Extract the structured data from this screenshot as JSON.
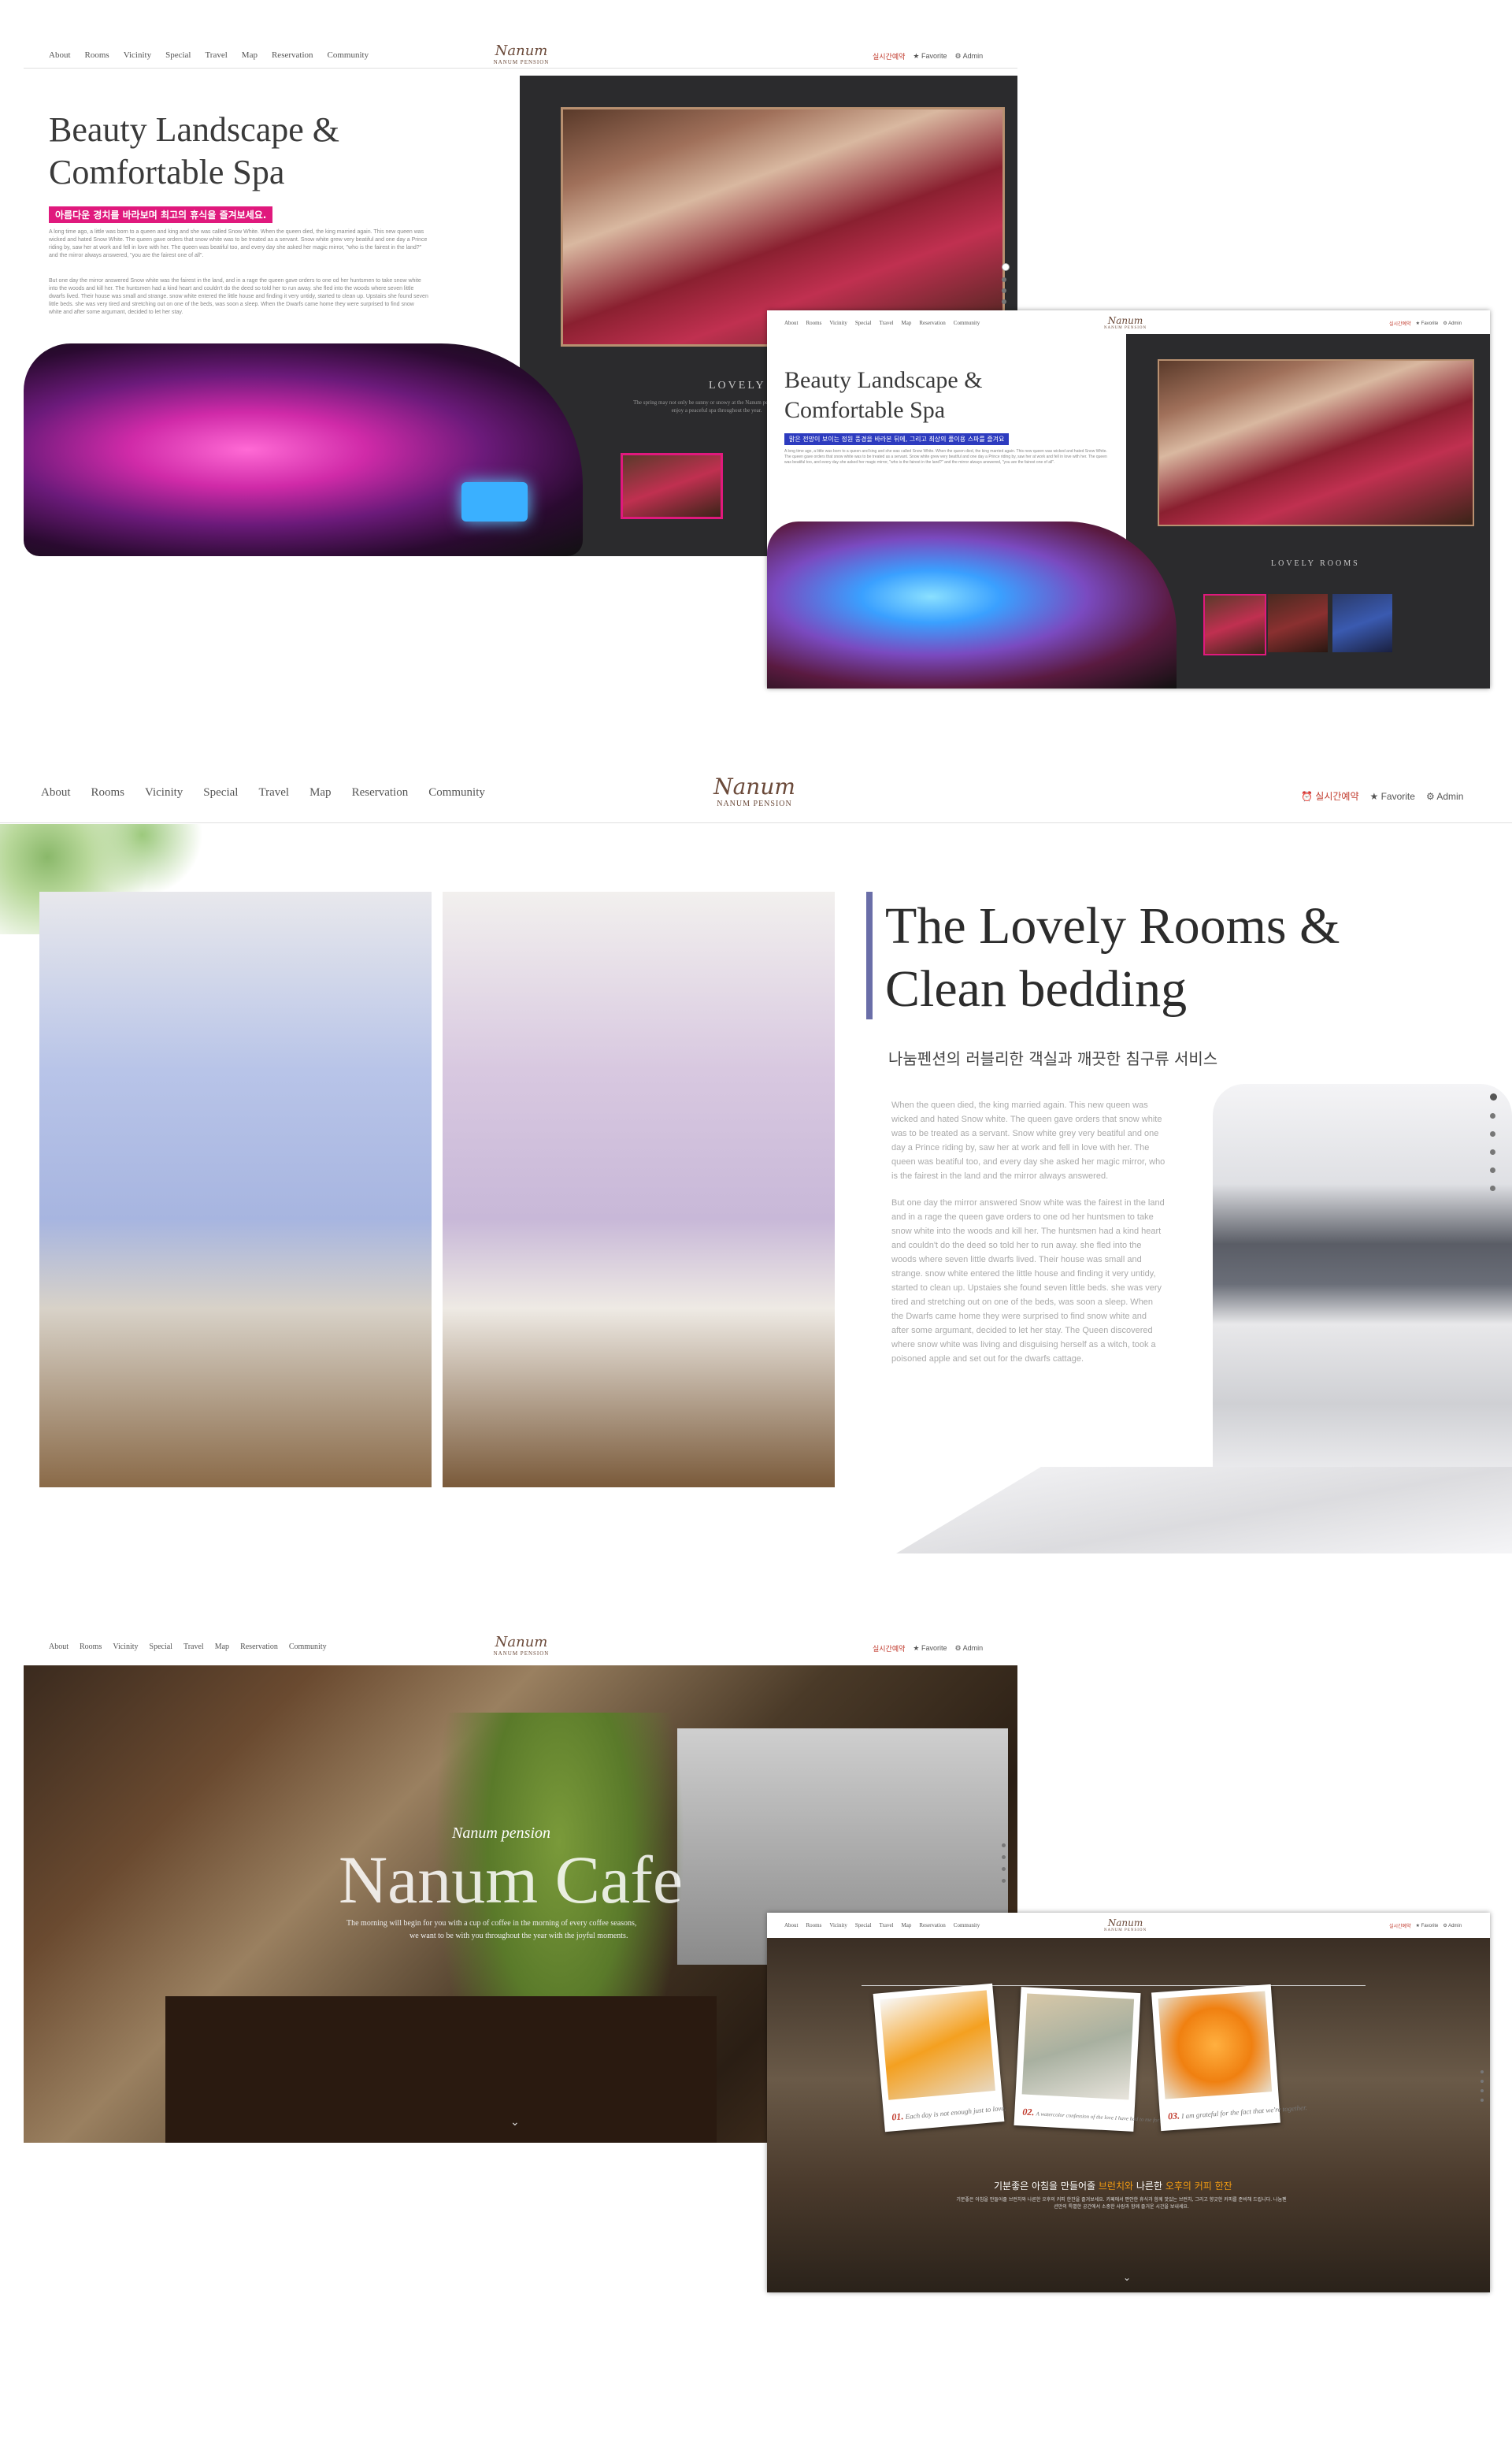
{
  "nav": [
    "About",
    "Rooms",
    "Vicinity",
    "Special",
    "Travel",
    "Map",
    "Reservation",
    "Community"
  ],
  "logo": {
    "script": "Nanum",
    "sub": "NANUM PENSION"
  },
  "util": {
    "reservation": "실시간예약",
    "favorite": "Favorite",
    "admin": "Admin"
  },
  "spa": {
    "title_line1": "Beauty Landscape &",
    "title_line2": "Comfortable Spa",
    "tagline": "아름다운 경치를 바라보며 최고의 휴식을 즐겨보세요.",
    "tagline_alt": "맑은 전망이 보이는 정원 풍경을 바라본 뒤에, 그리고 최상의 풀이용 스파를 즐겨요",
    "body1": "A long time ago, a little was born to a queen and king and she was called Snow White. When the queen died, the king married again. This new queen was wicked and hated Snow White. The queen gave orders that snow white was to be treated as a servant. Snow white grew very beatiful and one day a Prince riding by, saw her at work and fell in love with her. The queen was beatiful too, and every day she asked her magic mirror, \"who is the fairest in the land?\" and the mirror always answered, \"you are the fairest one of all\".",
    "body2": "But one day the mirror answered Snow white was the fairest in the land, and in a rage the queen gave orders to one od her huntsmen to take snow white into the woods and kill her. The huntsmen had a kind heart and couldn't do the deed so told her to run away. she fled into the woods where seven little dwarfs lived. Their house was small and strange. snow white entered the little house and finding it very untidy, started to clean up. Upstairs she found seven little beds. she was very tired and stretching out on one of the beds, was soon a sleep. When the Dwarfs came home they were surprised to find snow white and after some argumant, decided to let her stay.",
    "caption_title": "LOVELY ROOMS",
    "caption_text": "The spring may not only be sunny or snowy at the Nanum pension, you can enjoy a peaceful spa throughout the year."
  },
  "rooms": {
    "title_line1": "The Lovely Rooms &",
    "title_line2": "Clean bedding",
    "subtitle": "나눔펜션의 러블리한 객실과 깨끗한 침구류 서비스",
    "body1": "When the queen died, the king married again. This new queen was wicked and hated Snow white. The queen gave orders that snow white was to be treated as a servant. Snow white grey very beatiful and one day a Prince riding by, saw her at work and fell in love with her. The queen was beatiful too, and every day she asked her magic mirror, who is the fairest in the land and the mirror always answered.",
    "body2": "But one day the mirror answered Snow white was the fairest in the land and in a rage the queen gave orders to one od her huntsmen to take snow white into the woods and kill her. The huntsmen had a kind heart and couldn't do the deed so told her to run away. she fled into the woods where seven little dwarfs lived. Their house was small and strange. snow white entered the little house and finding it very untidy, started to clean up. Upstaies she found seven little beds. she was very tired and stretching out on one of the beds, was soon a sleep. When the Dwarfs came home they were surprised to find snow white and after some argumant, decided to let her stay. The Queen discovered where snow white was living and disguising herself as a witch, took a poisoned apple and set out for the dwarfs cattage."
  },
  "cafe": {
    "kicker": "Nanum pension",
    "title": "Nanum Cafe",
    "sub1": "The morning will begin for you with a cup of coffee in the morning of every coffee seasons,",
    "sub2": "we want to be with you throughout the year with the joyful moments.",
    "caption_1": "Each day is not enough just to love.",
    "caption_2": "A watercolor confession of the love I have had to me for you all these years",
    "caption_3": "I am grateful for the fact that we're together.",
    "num_1": "01.",
    "num_2": "02.",
    "num_3": "03.",
    "headline_pre": "기분좋은 아침을 만들어줄 ",
    "headline_hl1": "브런치와",
    "headline_mid": " 나른한 ",
    "headline_hl2": "오후의 커피 한잔",
    "body": "기분좋은 아침을 만들어줄 브런치와 나른한 오후의 커피 한잔을 즐겨보세요. 카페에서 편안한 휴식과 함께 맛있는 브런치, 그리고 향긋한 커피를 준비해 드립니다. 나눔펜션만의 특별한 공간에서 소중한 사람과 함께 즐거운 시간을 보내세요."
  },
  "colors": {
    "accent_pink": "#e0197d",
    "accent_blue": "#2d3bbf",
    "accent_red": "#c0392b",
    "accent_orange": "#f39c12",
    "rooms_bar": "#6a6ea8"
  }
}
